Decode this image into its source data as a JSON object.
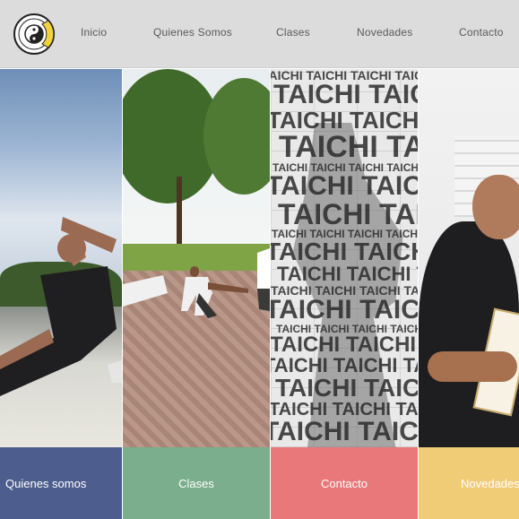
{
  "header": {
    "nav": [
      {
        "label": "Inicio"
      },
      {
        "label": "Quienes Somos"
      },
      {
        "label": "Clases"
      },
      {
        "label": "Novedades"
      },
      {
        "label": "Contacto"
      }
    ]
  },
  "panels": [
    {
      "label": "Quienes somos",
      "color": "#4d5e8e"
    },
    {
      "label": "Clases",
      "color": "#7aae8c"
    },
    {
      "label": "Contacto",
      "color": "#e9787a"
    },
    {
      "label": "Novedades",
      "color": "#f0cc76"
    }
  ],
  "taichi_word": "TAICHI",
  "colors": {
    "header_bg": "#dcdcdc",
    "nav_text": "#5a5a5a"
  },
  "icons": {
    "logo": "yin-yang-logo-icon"
  }
}
